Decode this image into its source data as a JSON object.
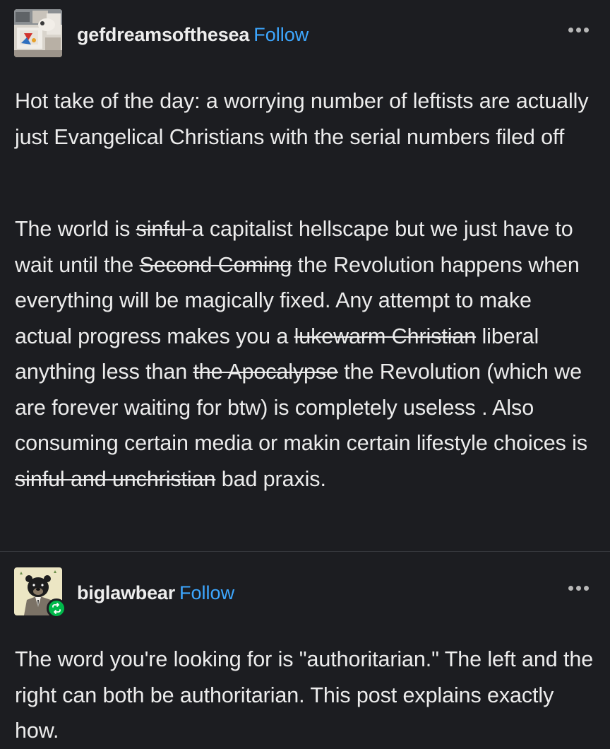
{
  "posts": [
    {
      "username": "gefdreamsofthesea",
      "follow_label": "Follow",
      "avatar_icon": "painting-avatar",
      "more_icon": "more-options-icon",
      "paragraphs": [
        {
          "text": "Hot take of the day: a worrying number of leftists are actually just Evangelical Christians  with the serial numbers filed off"
        },
        {
          "segments": [
            {
              "text": "The world is ",
              "struck": false
            },
            {
              "text": "sinful ",
              "struck": true
            },
            {
              "text": "a capitalist hellscape but we just have to wait until the ",
              "struck": false
            },
            {
              "text": "Second Coming",
              "struck": true
            },
            {
              "text": " the Revolution happens when everything will be magically fixed. Any attempt to make actual progress makes you a ",
              "struck": false
            },
            {
              "text": "lukewarm Christian",
              "struck": true
            },
            {
              "text": " liberal anything less than ",
              "struck": false
            },
            {
              "text": "the Apocalypse",
              "struck": true
            },
            {
              "text": " the Revolution (which we are forever waiting for btw) is completely useless . Also consuming certain media or makin certain lifestyle choices is ",
              "struck": false
            },
            {
              "text": "sinful and unchristian",
              "struck": true
            },
            {
              "text": " bad praxis.",
              "struck": false
            }
          ]
        }
      ]
    },
    {
      "username": "biglawbear",
      "follow_label": "Follow",
      "avatar_icon": "bear-in-suit-avatar",
      "badge_icon": "reblog-icon",
      "more_icon": "more-options-icon",
      "paragraphs": [
        {
          "text": "The word you're looking for is \"authoritarian.\" The left and the right can both be authoritarian. This post explains exactly how."
        }
      ]
    }
  ],
  "colors": {
    "background": "#1c1d21",
    "text": "#ececec",
    "follow_link": "#3da7ff",
    "divider": "#34363b",
    "reblog_badge": "#00b84a"
  }
}
